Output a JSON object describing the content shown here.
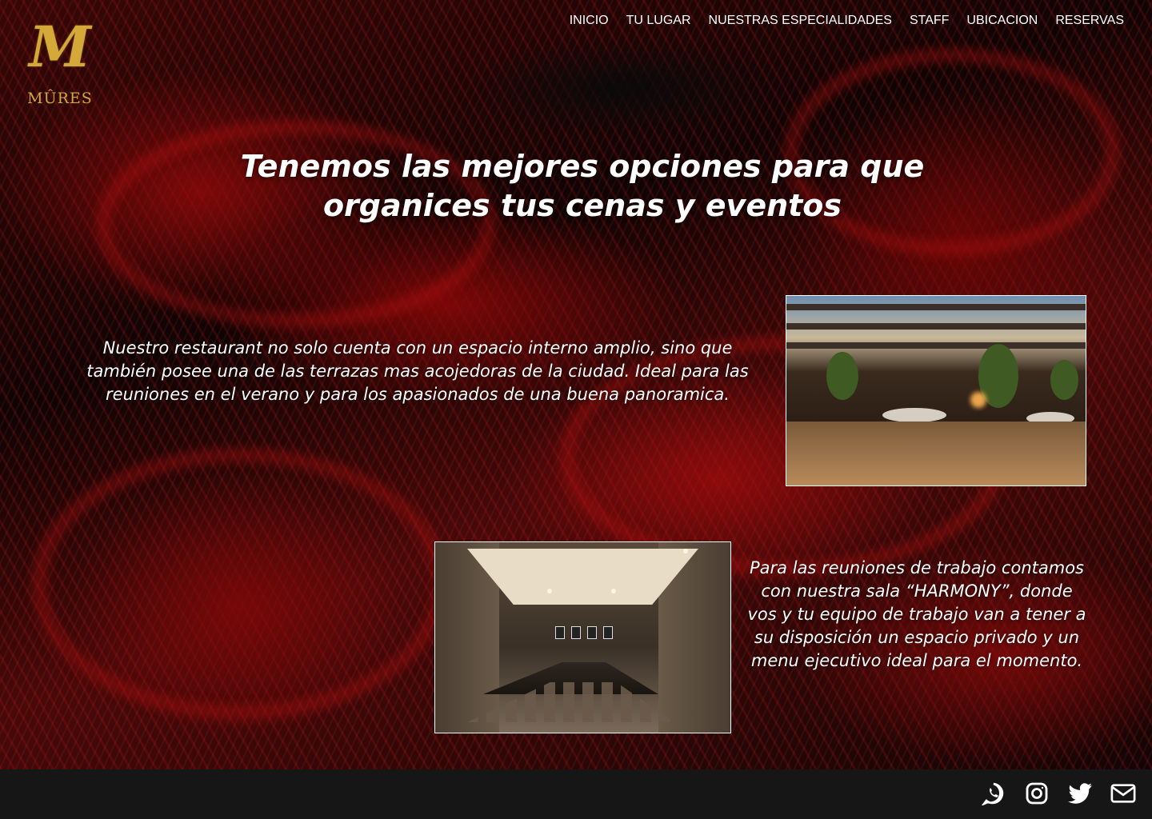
{
  "brand": {
    "logo_letter": "M",
    "name": "MÛRES",
    "accent_color": "#d4a93a"
  },
  "nav": {
    "items": [
      {
        "label": "INICIO"
      },
      {
        "label": "TU LUGAR"
      },
      {
        "label": "NUESTRAS ESPECIALIDADES"
      },
      {
        "label": "STAFF"
      },
      {
        "label": "UBICACION"
      },
      {
        "label": "RESERVAS"
      }
    ]
  },
  "hero": {
    "headline": "Tenemos las mejores opciones para que organices tus cenas y eventos"
  },
  "sections": [
    {
      "text": "Nuestro restaurant no solo cuenta con un espacio interno amplio, sino que también posee una de las terrazas mas acojedoras de la ciudad. Ideal para las reuniones en el verano y para los apasionados de una buena panoramica.",
      "image": "restaurant-terrace-photo"
    },
    {
      "text": "Para las reuniones de trabajo contamos con nuestra sala “HARMONY”, donde vos y tu equipo de trabajo van a tener a su disposición un espacio privado y un menu ejecutivo ideal para el momento.",
      "image": "harmony-meeting-room-photo"
    }
  ],
  "footer": {
    "background": "#161616",
    "social_icons": [
      "whatsapp-icon",
      "instagram-icon",
      "twitter-icon",
      "email-icon"
    ]
  }
}
